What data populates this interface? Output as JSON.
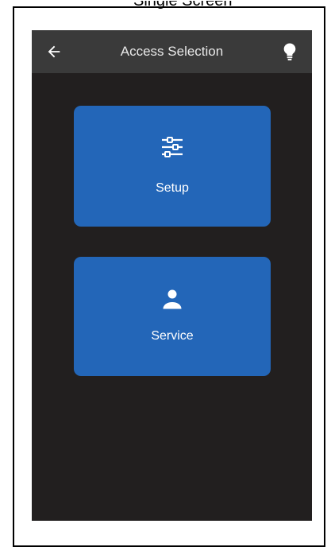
{
  "figure": {
    "caption_fragment": "Single Screen"
  },
  "appbar": {
    "title": "Access Selection",
    "back_icon": "arrow-left-icon",
    "help_icon": "lightbulb-icon"
  },
  "tiles": [
    {
      "label": "Setup",
      "icon": "sliders-icon"
    },
    {
      "label": "Service",
      "icon": "person-icon"
    }
  ],
  "colors": {
    "screen_background": "#221f1f",
    "appbar_background": "#3a3a3a",
    "tile_background": "#2366b8",
    "tile_text": "#ffffff"
  }
}
